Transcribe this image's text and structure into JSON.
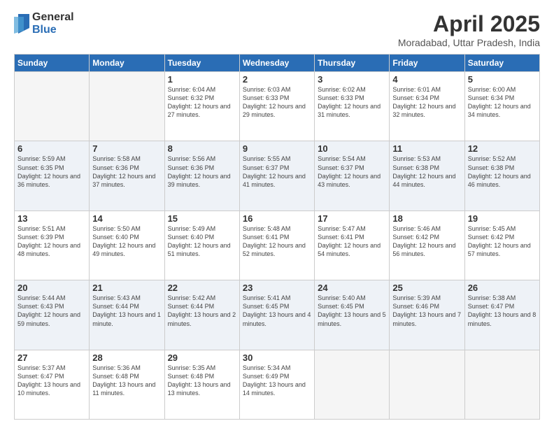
{
  "logo": {
    "general": "General",
    "blue": "Blue"
  },
  "title": "April 2025",
  "location": "Moradabad, Uttar Pradesh, India",
  "days_of_week": [
    "Sunday",
    "Monday",
    "Tuesday",
    "Wednesday",
    "Thursday",
    "Friday",
    "Saturday"
  ],
  "weeks": [
    [
      {
        "day": "",
        "empty": true
      },
      {
        "day": "",
        "empty": true
      },
      {
        "day": "1",
        "sunrise": "Sunrise: 6:04 AM",
        "sunset": "Sunset: 6:32 PM",
        "daylight": "Daylight: 12 hours and 27 minutes."
      },
      {
        "day": "2",
        "sunrise": "Sunrise: 6:03 AM",
        "sunset": "Sunset: 6:33 PM",
        "daylight": "Daylight: 12 hours and 29 minutes."
      },
      {
        "day": "3",
        "sunrise": "Sunrise: 6:02 AM",
        "sunset": "Sunset: 6:33 PM",
        "daylight": "Daylight: 12 hours and 31 minutes."
      },
      {
        "day": "4",
        "sunrise": "Sunrise: 6:01 AM",
        "sunset": "Sunset: 6:34 PM",
        "daylight": "Daylight: 12 hours and 32 minutes."
      },
      {
        "day": "5",
        "sunrise": "Sunrise: 6:00 AM",
        "sunset": "Sunset: 6:34 PM",
        "daylight": "Daylight: 12 hours and 34 minutes."
      }
    ],
    [
      {
        "day": "6",
        "sunrise": "Sunrise: 5:59 AM",
        "sunset": "Sunset: 6:35 PM",
        "daylight": "Daylight: 12 hours and 36 minutes."
      },
      {
        "day": "7",
        "sunrise": "Sunrise: 5:58 AM",
        "sunset": "Sunset: 6:36 PM",
        "daylight": "Daylight: 12 hours and 37 minutes."
      },
      {
        "day": "8",
        "sunrise": "Sunrise: 5:56 AM",
        "sunset": "Sunset: 6:36 PM",
        "daylight": "Daylight: 12 hours and 39 minutes."
      },
      {
        "day": "9",
        "sunrise": "Sunrise: 5:55 AM",
        "sunset": "Sunset: 6:37 PM",
        "daylight": "Daylight: 12 hours and 41 minutes."
      },
      {
        "day": "10",
        "sunrise": "Sunrise: 5:54 AM",
        "sunset": "Sunset: 6:37 PM",
        "daylight": "Daylight: 12 hours and 43 minutes."
      },
      {
        "day": "11",
        "sunrise": "Sunrise: 5:53 AM",
        "sunset": "Sunset: 6:38 PM",
        "daylight": "Daylight: 12 hours and 44 minutes."
      },
      {
        "day": "12",
        "sunrise": "Sunrise: 5:52 AM",
        "sunset": "Sunset: 6:38 PM",
        "daylight": "Daylight: 12 hours and 46 minutes."
      }
    ],
    [
      {
        "day": "13",
        "sunrise": "Sunrise: 5:51 AM",
        "sunset": "Sunset: 6:39 PM",
        "daylight": "Daylight: 12 hours and 48 minutes."
      },
      {
        "day": "14",
        "sunrise": "Sunrise: 5:50 AM",
        "sunset": "Sunset: 6:40 PM",
        "daylight": "Daylight: 12 hours and 49 minutes."
      },
      {
        "day": "15",
        "sunrise": "Sunrise: 5:49 AM",
        "sunset": "Sunset: 6:40 PM",
        "daylight": "Daylight: 12 hours and 51 minutes."
      },
      {
        "day": "16",
        "sunrise": "Sunrise: 5:48 AM",
        "sunset": "Sunset: 6:41 PM",
        "daylight": "Daylight: 12 hours and 52 minutes."
      },
      {
        "day": "17",
        "sunrise": "Sunrise: 5:47 AM",
        "sunset": "Sunset: 6:41 PM",
        "daylight": "Daylight: 12 hours and 54 minutes."
      },
      {
        "day": "18",
        "sunrise": "Sunrise: 5:46 AM",
        "sunset": "Sunset: 6:42 PM",
        "daylight": "Daylight: 12 hours and 56 minutes."
      },
      {
        "day": "19",
        "sunrise": "Sunrise: 5:45 AM",
        "sunset": "Sunset: 6:42 PM",
        "daylight": "Daylight: 12 hours and 57 minutes."
      }
    ],
    [
      {
        "day": "20",
        "sunrise": "Sunrise: 5:44 AM",
        "sunset": "Sunset: 6:43 PM",
        "daylight": "Daylight: 12 hours and 59 minutes."
      },
      {
        "day": "21",
        "sunrise": "Sunrise: 5:43 AM",
        "sunset": "Sunset: 6:44 PM",
        "daylight": "Daylight: 13 hours and 1 minute."
      },
      {
        "day": "22",
        "sunrise": "Sunrise: 5:42 AM",
        "sunset": "Sunset: 6:44 PM",
        "daylight": "Daylight: 13 hours and 2 minutes."
      },
      {
        "day": "23",
        "sunrise": "Sunrise: 5:41 AM",
        "sunset": "Sunset: 6:45 PM",
        "daylight": "Daylight: 13 hours and 4 minutes."
      },
      {
        "day": "24",
        "sunrise": "Sunrise: 5:40 AM",
        "sunset": "Sunset: 6:45 PM",
        "daylight": "Daylight: 13 hours and 5 minutes."
      },
      {
        "day": "25",
        "sunrise": "Sunrise: 5:39 AM",
        "sunset": "Sunset: 6:46 PM",
        "daylight": "Daylight: 13 hours and 7 minutes."
      },
      {
        "day": "26",
        "sunrise": "Sunrise: 5:38 AM",
        "sunset": "Sunset: 6:47 PM",
        "daylight": "Daylight: 13 hours and 8 minutes."
      }
    ],
    [
      {
        "day": "27",
        "sunrise": "Sunrise: 5:37 AM",
        "sunset": "Sunset: 6:47 PM",
        "daylight": "Daylight: 13 hours and 10 minutes."
      },
      {
        "day": "28",
        "sunrise": "Sunrise: 5:36 AM",
        "sunset": "Sunset: 6:48 PM",
        "daylight": "Daylight: 13 hours and 11 minutes."
      },
      {
        "day": "29",
        "sunrise": "Sunrise: 5:35 AM",
        "sunset": "Sunset: 6:48 PM",
        "daylight": "Daylight: 13 hours and 13 minutes."
      },
      {
        "day": "30",
        "sunrise": "Sunrise: 5:34 AM",
        "sunset": "Sunset: 6:49 PM",
        "daylight": "Daylight: 13 hours and 14 minutes."
      },
      {
        "day": "",
        "empty": true
      },
      {
        "day": "",
        "empty": true
      },
      {
        "day": "",
        "empty": true
      }
    ]
  ]
}
